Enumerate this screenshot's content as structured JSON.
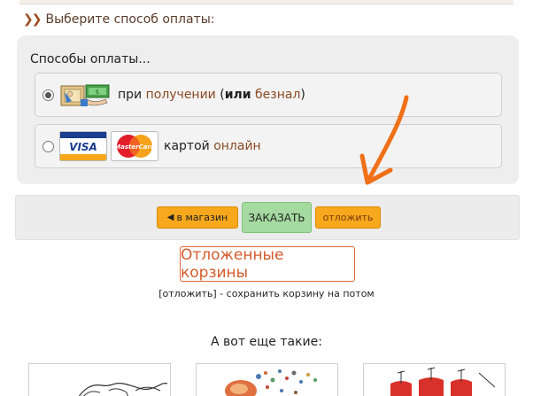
{
  "section": {
    "heading": "Выберите способ оплаты:"
  },
  "payment": {
    "title": "Способы оплаты...",
    "options": [
      {
        "selected": true,
        "prefix": "при",
        "link1": "получении",
        "open": "(",
        "bold": "или",
        "link2": "безнал",
        "close": ")",
        "icon": "cash-courier-icon"
      },
      {
        "selected": false,
        "prefix": "картой",
        "link1": "онлайн",
        "icons": [
          "visa-icon",
          "mastercard-icon"
        ],
        "visa_label": "VISA",
        "mc_label": "MasterCard"
      }
    ]
  },
  "actions": {
    "back_label": "в магазин",
    "order_label": "ЗАКАЗАТЬ",
    "later_label": "отложить"
  },
  "saved": {
    "button_label": "Отложенные корзины",
    "note": "[отложить] - сохранить корзину на потом"
  },
  "more": {
    "heading": "А вот еще такие:"
  },
  "colors": {
    "accent_orange": "#f7a81c",
    "order_green": "#a5dba0",
    "link_brown": "#8a4a22",
    "saved_red": "#d45a2c",
    "annotation_arrow": "#f07018"
  }
}
